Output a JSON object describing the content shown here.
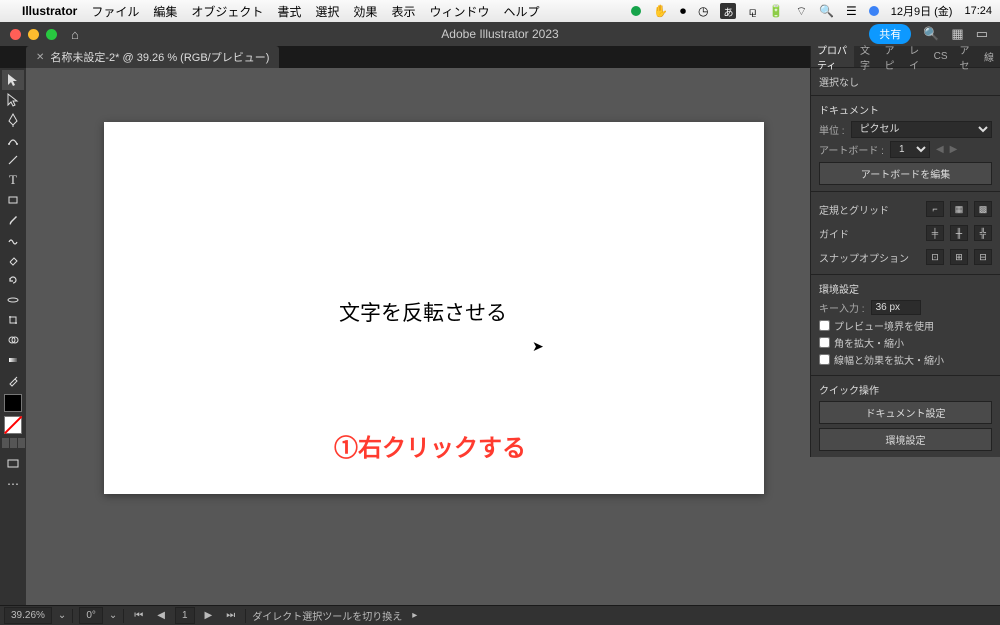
{
  "mac_menu": {
    "app_name": "Illustrator",
    "items": [
      "ファイル",
      "編集",
      "オブジェクト",
      "書式",
      "選択",
      "効果",
      "表示",
      "ウィンドウ",
      "ヘルプ"
    ],
    "date": "12月9日 (金)",
    "time": "17:24",
    "jp_box": "あ"
  },
  "app": {
    "title": "Adobe Illustrator 2023",
    "share": "共有"
  },
  "doc_tab": {
    "label": "名称未設定-2* @ 39.26 % (RGB/プレビュー)"
  },
  "canvas": {
    "text1": "文字を反転させる",
    "annotation": "①右クリックする"
  },
  "panel": {
    "tabs": [
      "プロパティ",
      "文字",
      "アピ",
      "レイ",
      "CS",
      "アセ",
      "線"
    ],
    "selection": "選択なし",
    "document_label": "ドキュメント",
    "unit_label": "単位 :",
    "unit_value": "ピクセル",
    "artboard_label": "アートボード :",
    "artboard_value": "1",
    "edit_artboard": "アートボードを編集",
    "ruler_grid": "定規とグリッド",
    "guide": "ガイド",
    "snap": "スナップオプション",
    "prefs_label": "環境設定",
    "key_input_label": "キー入力 :",
    "key_input_value": "36 px",
    "check_preview": "プレビュー境界を使用",
    "check_corner": "角を拡大・縮小",
    "check_stroke": "線幅と効果を拡大・縮小",
    "quick_ops": "クイック操作",
    "doc_settings": "ドキュメント設定",
    "env_settings": "環境設定"
  },
  "status": {
    "zoom": "39.26%",
    "rotate": "0°",
    "artboard": "1",
    "hint": "ダイレクト選択ツールを切り換え"
  }
}
